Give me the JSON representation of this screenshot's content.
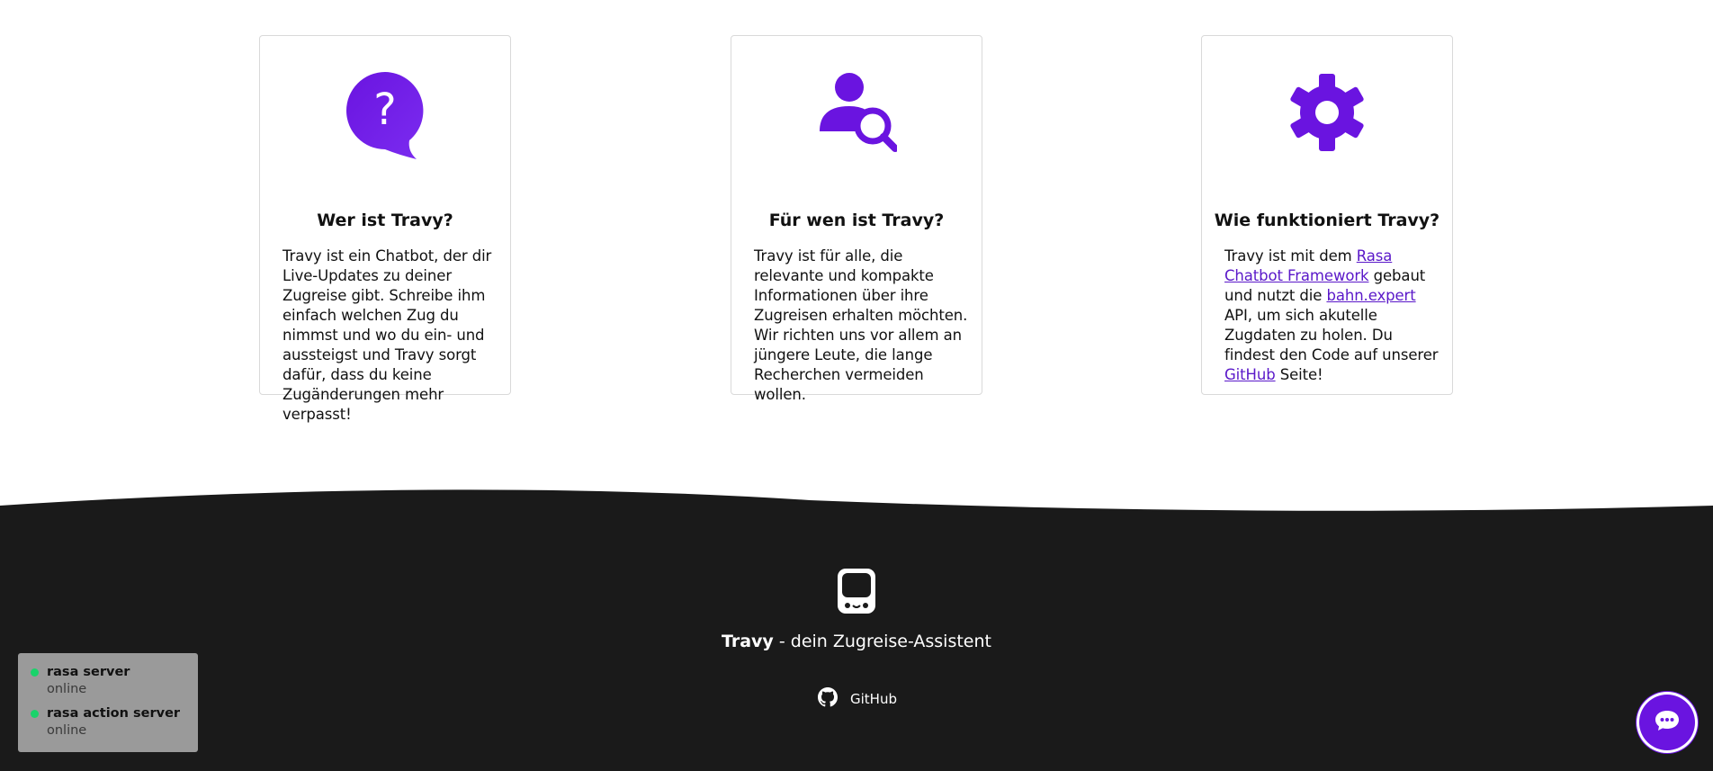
{
  "cards": [
    {
      "icon": "question-bubble-icon",
      "title": "Wer ist Travy?",
      "text": "Travy ist ein Chatbot, der dir Live-Updates zu deiner Zugreise gibt. Schreibe ihm einfach welchen Zug du nimmst und wo du ein- und aussteigst und Travy sorgt dafür, dass du keine Zugänderungen mehr verpasst!"
    },
    {
      "icon": "user-search-icon",
      "title": "Für wen ist Travy?",
      "text": "Travy ist für alle, die relevante und kompakte Informationen über ihre Zugreisen erhalten möchten. Wir richten uns vor allem an jüngere Leute, die lange Recherchen vermeiden wollen."
    },
    {
      "icon": "gear-icon",
      "title": "Wie funktioniert Travy?",
      "text_parts": {
        "t1": "Travy ist mit dem ",
        "link1": "Rasa Chatbot Framework",
        "t2": " gebaut und nutzt die ",
        "link2": "bahn.expert",
        "t3": " API, um sich akutelle Zugdaten zu holen. Du findest den Code auf unserer ",
        "link3": "GitHub",
        "t4": " Seite!"
      }
    }
  ],
  "footer": {
    "brand": "Travy",
    "tagline_rest": " - dein Zugreise-Assistent",
    "github_label": "GitHub"
  },
  "status": [
    {
      "name": "rasa server",
      "state": "online"
    },
    {
      "name": "rasa action server",
      "state": "online"
    }
  ],
  "colors": {
    "accent": "#6a14e0",
    "footer_bg": "#1a1a1a",
    "status_online": "#19d36a"
  }
}
